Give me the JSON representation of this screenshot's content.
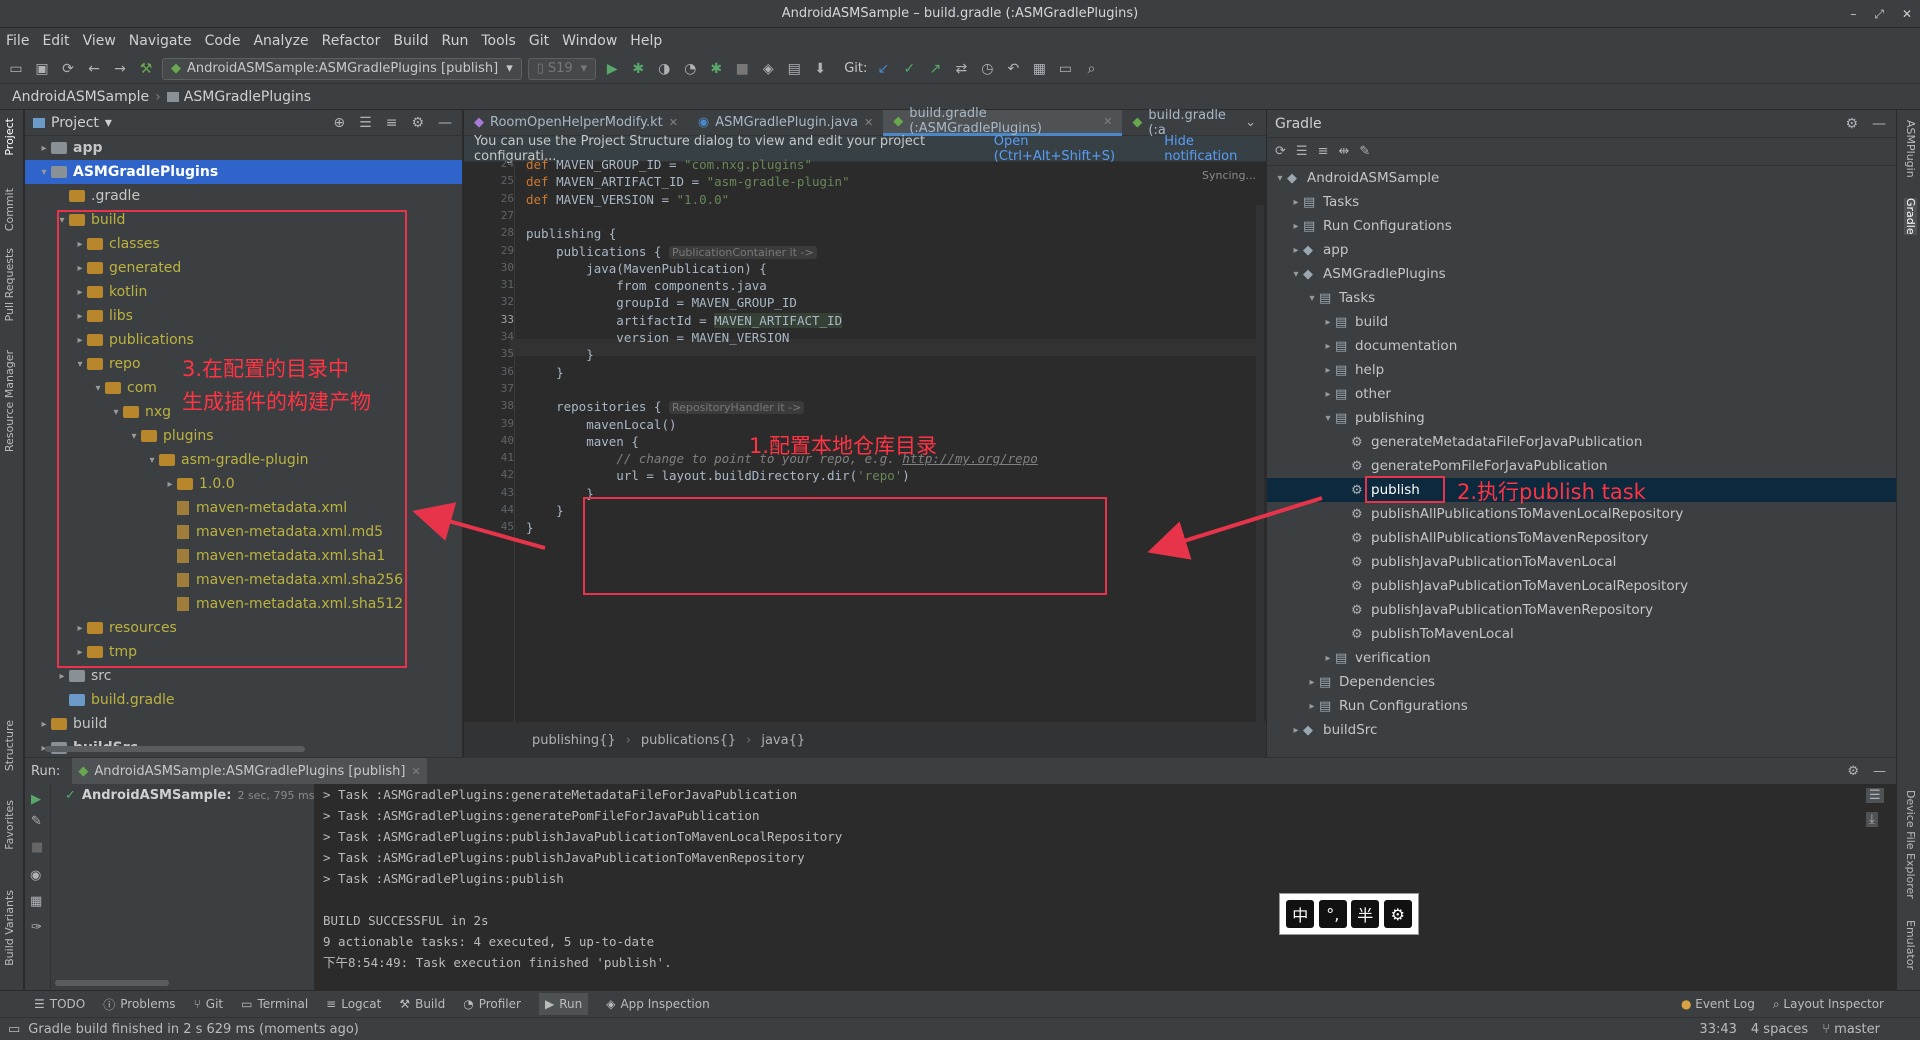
{
  "window": {
    "title": "AndroidASMSample – build.gradle (:ASMGradlePlugins)",
    "controls": [
      "–",
      "⤢",
      "✕"
    ]
  },
  "menu": [
    "File",
    "Edit",
    "View",
    "Navigate",
    "Code",
    "Analyze",
    "Refactor",
    "Build",
    "Run",
    "Tools",
    "Git",
    "Window",
    "Help"
  ],
  "toolbar": {
    "run_config": "AndroidASMSample:ASMGradlePlugins [publish]",
    "device": "S19",
    "git_label": "Git:"
  },
  "navbar": {
    "crumbs": [
      "AndroidASMSample",
      "ASMGradlePlugins"
    ]
  },
  "left_strip": [
    "Project",
    "Commit",
    "Pull Requests",
    "Resource Manager",
    "Structure",
    "Favorites",
    "Build Variants"
  ],
  "right_strip": [
    "ASMPlugin",
    "Gradle",
    "Device File Explorer",
    "Emulator"
  ],
  "project": {
    "title": "Project",
    "rows": [
      {
        "label": "app",
        "indent": 1,
        "arrow": "▸",
        "icon": "gray",
        "bold": true
      },
      {
        "label": "ASMGradlePlugins",
        "indent": 1,
        "arrow": "▾",
        "icon": "gray",
        "bold": true,
        "selected": true
      },
      {
        "label": ".gradle",
        "indent": 2,
        "arrow": "",
        "icon": "org"
      },
      {
        "label": "build",
        "indent": 2,
        "arrow": "▾",
        "icon": "org",
        "yellow": true
      },
      {
        "label": "classes",
        "indent": 3,
        "arrow": "▸",
        "icon": "org",
        "yellow": true
      },
      {
        "label": "generated",
        "indent": 3,
        "arrow": "▸",
        "icon": "org",
        "yellow": true
      },
      {
        "label": "kotlin",
        "indent": 3,
        "arrow": "▸",
        "icon": "org",
        "yellow": true
      },
      {
        "label": "libs",
        "indent": 3,
        "arrow": "▸",
        "icon": "org",
        "yellow": true
      },
      {
        "label": "publications",
        "indent": 3,
        "arrow": "▸",
        "icon": "org",
        "yellow": true
      },
      {
        "label": "repo",
        "indent": 3,
        "arrow": "▾",
        "icon": "org",
        "yellow": true
      },
      {
        "label": "com",
        "indent": 4,
        "arrow": "▾",
        "icon": "org",
        "yellow": true
      },
      {
        "label": "nxg",
        "indent": 5,
        "arrow": "▾",
        "icon": "org",
        "yellow": true
      },
      {
        "label": "plugins",
        "indent": 6,
        "arrow": "▾",
        "icon": "org",
        "yellow": true
      },
      {
        "label": "asm-gradle-plugin",
        "indent": 7,
        "arrow": "▾",
        "icon": "org",
        "yellow": true
      },
      {
        "label": "1.0.0",
        "indent": 8,
        "arrow": "▸",
        "icon": "org",
        "yellow": true
      },
      {
        "label": "maven-metadata.xml",
        "indent": 8,
        "arrow": "",
        "icon": "file",
        "yellow": true
      },
      {
        "label": "maven-metadata.xml.md5",
        "indent": 8,
        "arrow": "",
        "icon": "file",
        "yellow": true
      },
      {
        "label": "maven-metadata.xml.sha1",
        "indent": 8,
        "arrow": "",
        "icon": "file",
        "yellow": true
      },
      {
        "label": "maven-metadata.xml.sha256",
        "indent": 8,
        "arrow": "",
        "icon": "file",
        "yellow": true
      },
      {
        "label": "maven-metadata.xml.sha512",
        "indent": 8,
        "arrow": "",
        "icon": "file",
        "yellow": true
      },
      {
        "label": "resources",
        "indent": 3,
        "arrow": "▸",
        "icon": "org",
        "yellow": true
      },
      {
        "label": "tmp",
        "indent": 3,
        "arrow": "▸",
        "icon": "org",
        "yellow": true
      },
      {
        "label": "src",
        "indent": 2,
        "arrow": "▸",
        "icon": "gray"
      },
      {
        "label": "build.gradle",
        "indent": 2,
        "arrow": "",
        "icon": "blu",
        "yellow": true
      },
      {
        "label": "build",
        "indent": 1,
        "arrow": "▸",
        "icon": "org"
      },
      {
        "label": "buildSrc",
        "indent": 1,
        "arrow": "▸",
        "icon": "gray",
        "bold": true
      }
    ]
  },
  "editor": {
    "tabs": [
      {
        "label": "RoomOpenHelperModify.kt",
        "active": false
      },
      {
        "label": "ASMGradlePlugin.java",
        "active": false
      },
      {
        "label": "build.gradle (:ASMGradlePlugins)",
        "active": true
      },
      {
        "label": "build.gradle (:a",
        "active": false
      }
    ],
    "notification": {
      "text": "You can use the Project Structure dialog to view and edit your project configurati...",
      "open_link": "Open (Ctrl+Alt+Shift+S)",
      "hide_link": "Hide notification"
    },
    "syncing": "Syncing...",
    "lines": [
      {
        "n": "24",
        "html": "<span class='kw'>def</span> MAVEN_GROUP_ID = <span class='str'>\"com.nxg.plugins\"</span>"
      },
      {
        "n": "25",
        "html": "<span class='kw'>def</span> MAVEN_ARTIFACT_ID = <span class='str'>\"asm-gradle-plugin\"</span>"
      },
      {
        "n": "26",
        "html": "<span class='kw'>def</span> MAVEN_VERSION = <span class='str'>\"1.0.0\"</span>"
      },
      {
        "n": "27",
        "html": ""
      },
      {
        "n": "28",
        "html": "publishing {"
      },
      {
        "n": "29",
        "html": "    publications { <span class='hint'>PublicationContainer it -&gt;</span>"
      },
      {
        "n": "30",
        "html": "        java(MavenPublication) {"
      },
      {
        "n": "31",
        "html": "            from components.java"
      },
      {
        "n": "32",
        "html": "            groupId = MAVEN_GROUP_ID"
      },
      {
        "n": "33",
        "html": "            artifactId = MAVEN_ARTIFACT_ID"
      },
      {
        "n": "34",
        "html": "            version = MAVEN_VERSION"
      },
      {
        "n": "35",
        "html": "        }"
      },
      {
        "n": "36",
        "html": "    }"
      },
      {
        "n": "37",
        "html": ""
      },
      {
        "n": "38",
        "html": "    repositories { <span class='hint'>RepositoryHandler it -&gt;</span>"
      },
      {
        "n": "39",
        "html": "        mavenLocal()"
      },
      {
        "n": "40",
        "html": "        maven {"
      },
      {
        "n": "41",
        "html": "            <span class='cm'>// change to point to your repo, e.g. <u>http://my.org/repo</u></span>"
      },
      {
        "n": "42",
        "html": "            url = layout.buildDirectory.dir(<span class='str'>'repo'</span>)"
      },
      {
        "n": "43",
        "html": "        }"
      },
      {
        "n": "44",
        "html": "    }"
      },
      {
        "n": "45",
        "html": "}"
      }
    ],
    "breadcrumbs": [
      "publishing{}",
      "publications{}",
      "java{}"
    ]
  },
  "gradle": {
    "title": "Gradle",
    "rows": [
      {
        "label": "AndroidASMSample",
        "indent": 0,
        "arrow": "▾",
        "icon": "elephant"
      },
      {
        "label": "Tasks",
        "indent": 1,
        "arrow": "▸",
        "icon": "folder"
      },
      {
        "label": "Run Configurations",
        "indent": 1,
        "arrow": "▸",
        "icon": "folder"
      },
      {
        "label": "app",
        "indent": 1,
        "arrow": "▸",
        "icon": "elephant"
      },
      {
        "label": "ASMGradlePlugins",
        "indent": 1,
        "arrow": "▾",
        "icon": "elephant"
      },
      {
        "label": "Tasks",
        "indent": 2,
        "arrow": "▾",
        "icon": "folder"
      },
      {
        "label": "build",
        "indent": 3,
        "arrow": "▸",
        "icon": "folder"
      },
      {
        "label": "documentation",
        "indent": 3,
        "arrow": "▸",
        "icon": "folder"
      },
      {
        "label": "help",
        "indent": 3,
        "arrow": "▸",
        "icon": "folder"
      },
      {
        "label": "other",
        "indent": 3,
        "arrow": "▸",
        "icon": "folder"
      },
      {
        "label": "publishing",
        "indent": 3,
        "arrow": "▾",
        "icon": "folder"
      },
      {
        "label": "generateMetadataFileForJavaPublication",
        "indent": 4,
        "arrow": "",
        "icon": "gear"
      },
      {
        "label": "generatePomFileForJavaPublication",
        "indent": 4,
        "arrow": "",
        "icon": "gear"
      },
      {
        "label": "publish",
        "indent": 4,
        "arrow": "",
        "icon": "gear",
        "selected": true
      },
      {
        "label": "publishAllPublicationsToMavenLocalRepository",
        "indent": 4,
        "arrow": "",
        "icon": "gear"
      },
      {
        "label": "publishAllPublicationsToMavenRepository",
        "indent": 4,
        "arrow": "",
        "icon": "gear"
      },
      {
        "label": "publishJavaPublicationToMavenLocal",
        "indent": 4,
        "arrow": "",
        "icon": "gear"
      },
      {
        "label": "publishJavaPublicationToMavenLocalRepository",
        "indent": 4,
        "arrow": "",
        "icon": "gear"
      },
      {
        "label": "publishJavaPublicationToMavenRepository",
        "indent": 4,
        "arrow": "",
        "icon": "gear"
      },
      {
        "label": "publishToMavenLocal",
        "indent": 4,
        "arrow": "",
        "icon": "gear"
      },
      {
        "label": "verification",
        "indent": 3,
        "arrow": "▸",
        "icon": "folder"
      },
      {
        "label": "Dependencies",
        "indent": 2,
        "arrow": "▸",
        "icon": "folder"
      },
      {
        "label": "Run Configurations",
        "indent": 2,
        "arrow": "▸",
        "icon": "folder"
      },
      {
        "label": "buildSrc",
        "indent": 1,
        "arrow": "▸",
        "icon": "elephant"
      }
    ]
  },
  "run": {
    "label": "Run:",
    "tab": "AndroidASMSample:ASMGradlePlugins [publish]",
    "tree_item": "AndroidASMSample:",
    "tree_time": "2 sec, 795 ms",
    "console": [
      "> Task :ASMGradlePlugins:generateMetadataFileForJavaPublication",
      "> Task :ASMGradlePlugins:generatePomFileForJavaPublication",
      "> Task :ASMGradlePlugins:publishJavaPublicationToMavenLocalRepository",
      "> Task :ASMGradlePlugins:publishJavaPublicationToMavenRepository",
      "> Task :ASMGradlePlugins:publish",
      "",
      "BUILD SUCCESSFUL in 2s",
      "9 actionable tasks: 4 executed, 5 up-to-date",
      "下午8:54:49: Task execution finished 'publish'."
    ]
  },
  "bottom_tabs": [
    "TODO",
    "Problems",
    "Git",
    "Terminal",
    "Logcat",
    "Build",
    "Profiler",
    "Run",
    "App Inspection"
  ],
  "bottom_right": [
    "Event Log",
    "Layout Inspector"
  ],
  "status": {
    "message": "Gradle build finished in 2 s 629 ms (moments ago)",
    "position": "33:43",
    "indent": "4 spaces",
    "branch": "master"
  },
  "ime": [
    "中",
    "°,",
    "半",
    "⚙"
  ],
  "annotations": {
    "a1": "1.配置本地仓库目录",
    "a2": "2.执行publish task",
    "a3_line1": "3.在配置的目录中",
    "a3_line2": "生成插件的构建产物",
    "color": "#e8344a"
  }
}
